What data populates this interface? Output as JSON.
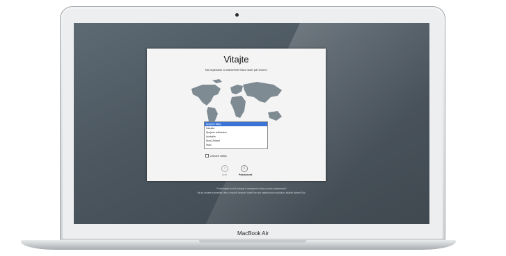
{
  "device": {
    "brand": "MacBook Air"
  },
  "window": {
    "title": "Vitajte",
    "subtitle": "Na registráciu a nastavenie Macu stačí pár krokov.",
    "countries": [
      "Spojené štáty",
      "Kanada",
      "Spojené kráľovstvo",
      "Austrália",
      "Nový Zéland",
      "Írsko"
    ],
    "selected_index": 0,
    "show_all_label": "Zobraziť všetky",
    "back_label": "Späť",
    "continue_label": "Pokračovať"
  },
  "footer": {
    "line1": "Potrebujete počuť pokyny k nastaveniu Macu počas nastavenia?",
    "line2": "Ak sa chcete dozvedieť viac o využití funkcie VoiceOver pri nastavovaní počítača, stlačte kláves Esc."
  }
}
